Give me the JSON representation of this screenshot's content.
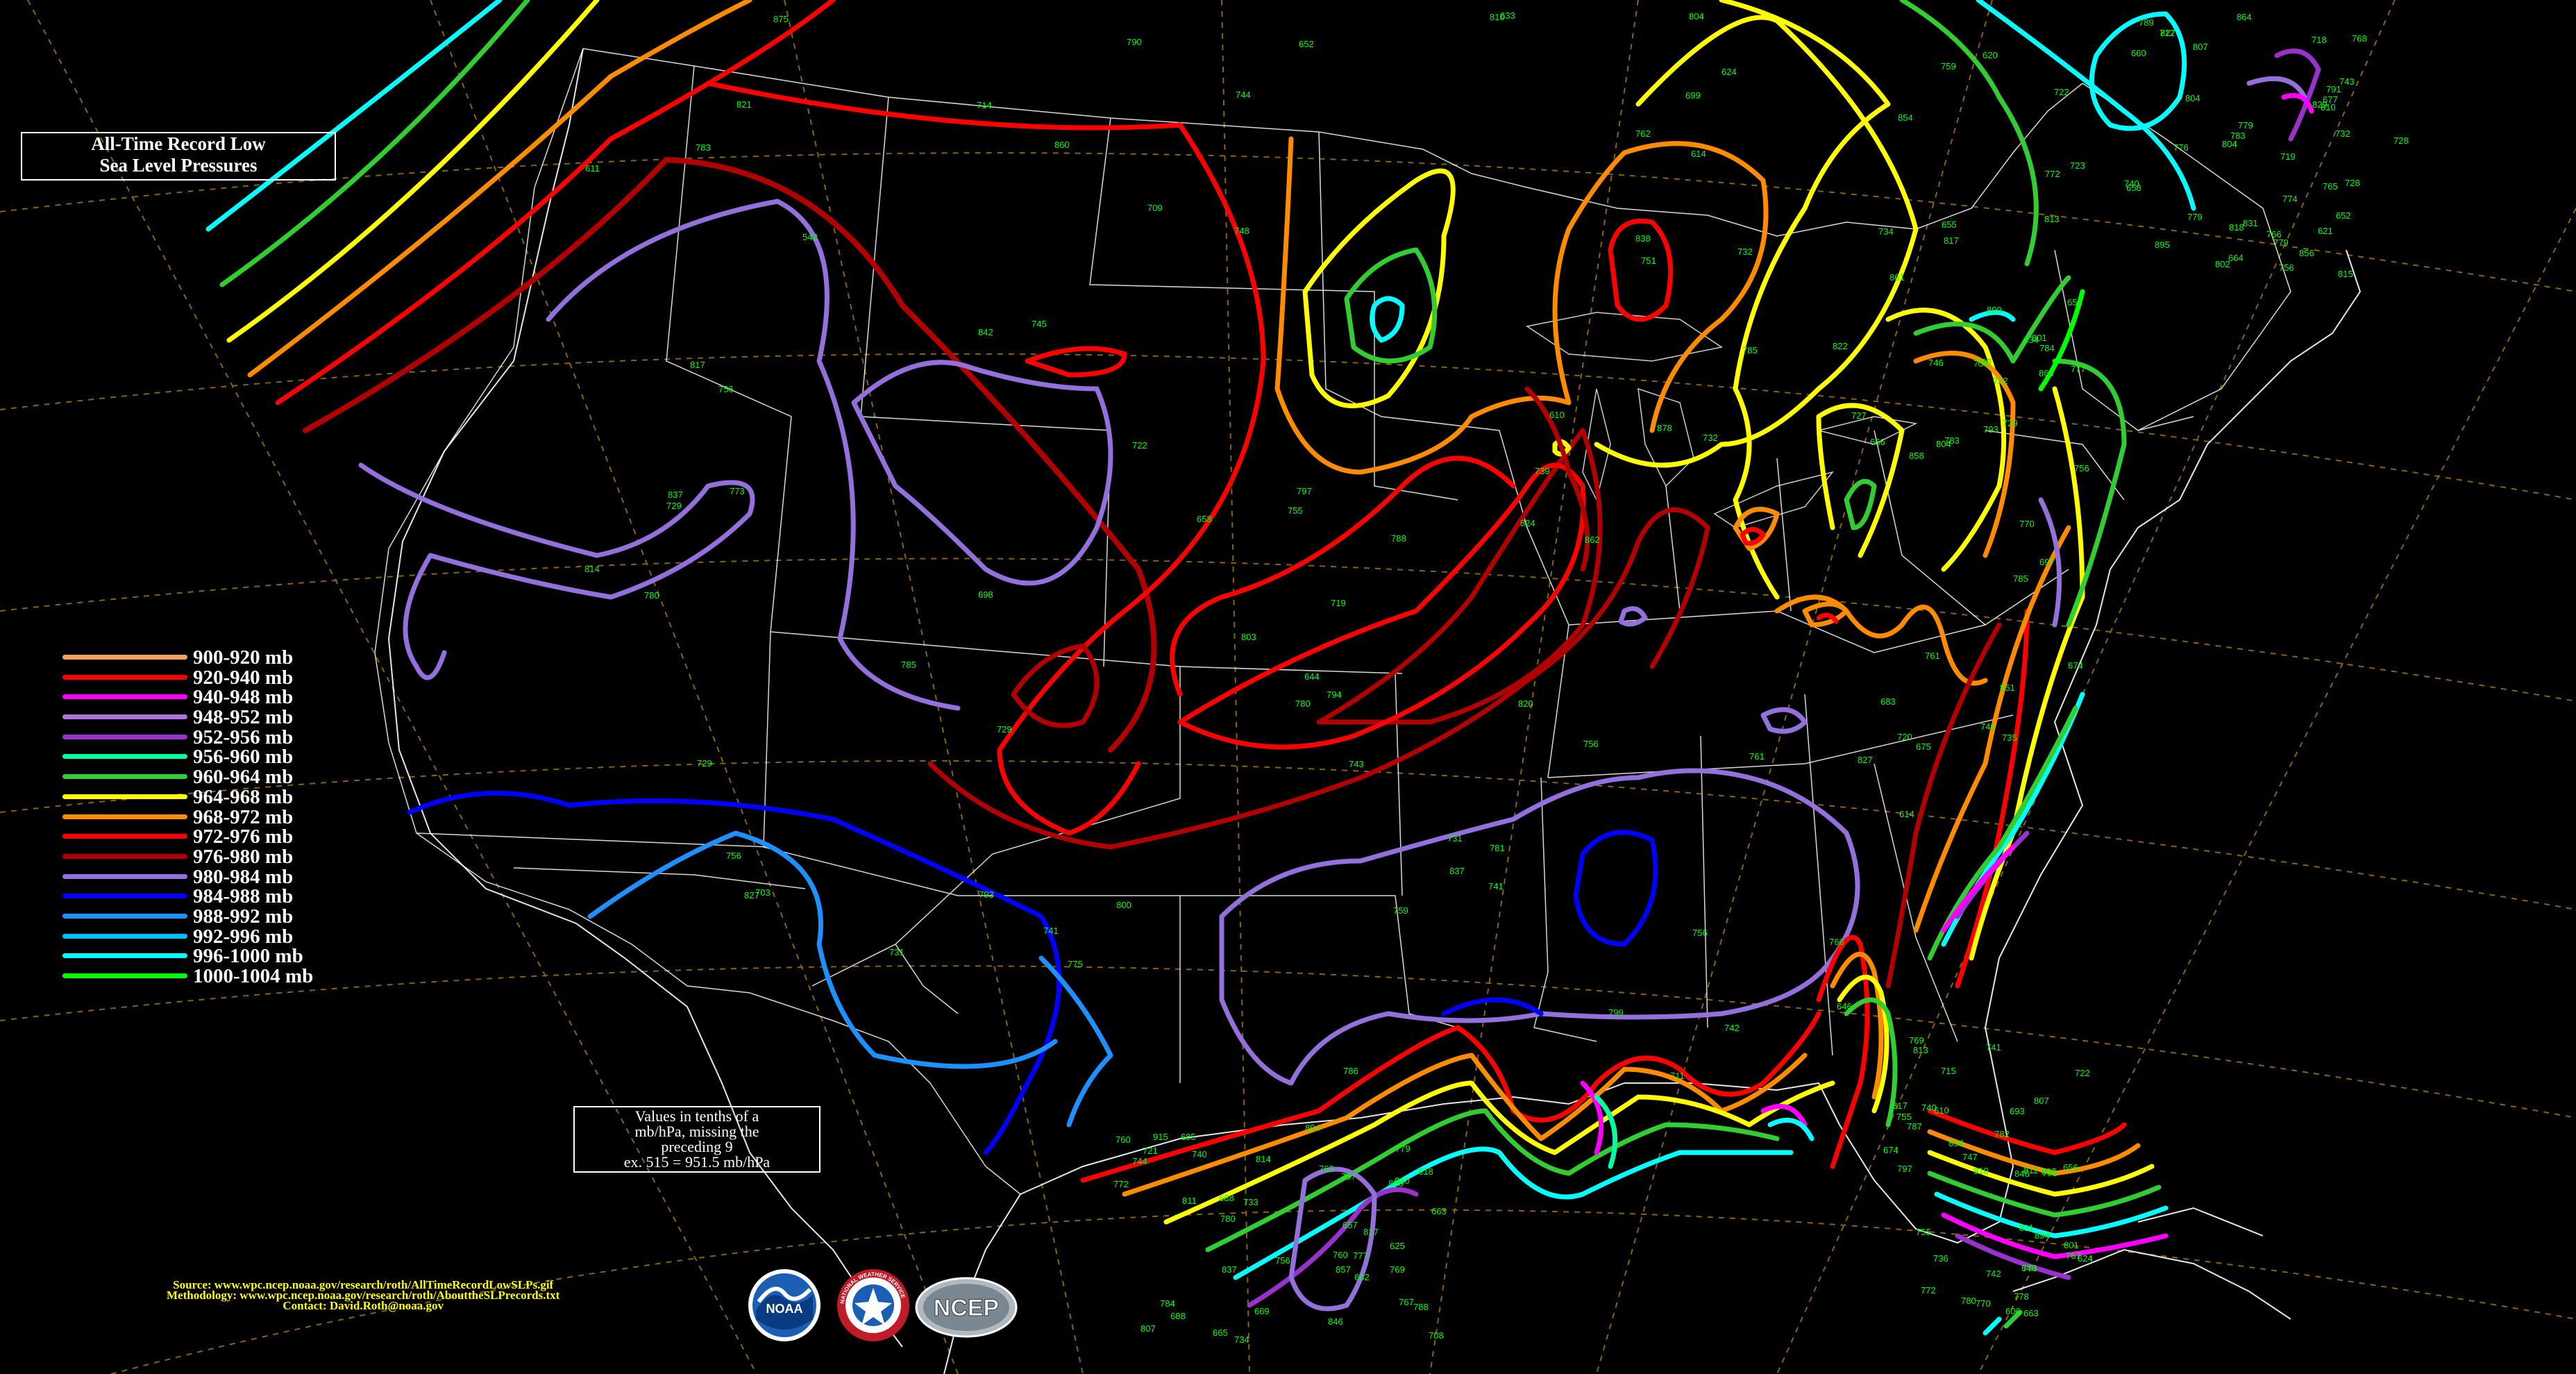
{
  "title": {
    "line1": "All-Time Record Low",
    "line2": "Sea Level Pressures"
  },
  "note": {
    "line1": "Values in tenths of a",
    "line2": "mb/hPa, missing the",
    "line3": "preceding 9",
    "line4": "ex. 515 = 951.5 mb/hPa"
  },
  "legend": [
    {
      "label": "900-920 mb",
      "color": "#f4a460"
    },
    {
      "label": "920-940 mb",
      "color": "#ff0000"
    },
    {
      "label": "940-948 mb",
      "color": "#ff00ff"
    },
    {
      "label": "948-952 mb",
      "color": "#b070e0"
    },
    {
      "label": "952-956 mb",
      "color": "#9932cc"
    },
    {
      "label": "956-960 mb",
      "color": "#00ffa0"
    },
    {
      "label": "960-964 mb",
      "color": "#32cd32"
    },
    {
      "label": "964-968 mb",
      "color": "#ffff00"
    },
    {
      "label": "968-972 mb",
      "color": "#ff8c00"
    },
    {
      "label": "972-976 mb",
      "color": "#ff0000"
    },
    {
      "label": "976-980 mb",
      "color": "#b00000"
    },
    {
      "label": "980-984 mb",
      "color": "#9370db"
    },
    {
      "label": "984-988 mb",
      "color": "#0000ff"
    },
    {
      "label": "988-992 mb",
      "color": "#1e90ff"
    },
    {
      "label": "992-996 mb",
      "color": "#00bfff"
    },
    {
      "label": "996-1000 mb",
      "color": "#00ffff"
    },
    {
      "label": "1000-1004 mb",
      "color": "#00ff00"
    }
  ],
  "credits": {
    "source": "Source: www.wpc.ncep.noaa.gov/research/roth/AllTimeRecordLowSLPs.gif",
    "methodology": "Methodology: www.wpc.ncep.noaa.gov/research/roth/AbouttheSLPrecords.txt",
    "contact": "Contact:  David.Roth@noaa.gov"
  },
  "logos": {
    "noaa": "NOAA",
    "nws": "NATIONAL WEATHER SERVICE",
    "ncep": "NCEP"
  },
  "station_values": [
    "745",
    "711",
    "697",
    "688",
    "646",
    "677",
    "709",
    "751",
    "761",
    "788",
    "797",
    "810",
    "756",
    "766",
    "753",
    "779",
    "787",
    "804",
    "797",
    "732",
    "740",
    "810",
    "742",
    "718",
    "714",
    "732",
    "813",
    "733",
    "780",
    "864",
    "783",
    "804",
    "817",
    "814",
    "805",
    "766",
    "729",
    "719",
    "793",
    "787",
    "770",
    "776",
    "803",
    "794",
    "801",
    "769",
    "736",
    "728",
    "780",
    "756",
    "785",
    "807",
    "817",
    "831",
    "827",
    "837",
    "739",
    "772",
    "773",
    "815",
    "793",
    "810",
    "804",
    "857",
    "846",
    "856",
    "860",
    "838",
    "865",
    "837",
    "854",
    "804",
    "814",
    "827",
    "851",
    "888",
    "910",
    "895",
    "875",
    "878",
    "854",
    "915",
    "894",
    "829",
    "837",
    "822",
    "720",
    "734",
    "740",
    "756",
    "729",
    "741",
    "783",
    "817",
    "811",
    "807",
    "790",
    "788",
    "800",
    "777",
    "782",
    "779",
    "842",
    "646",
    "634",
    "618",
    "674",
    "664",
    "652",
    "610",
    "675",
    "665",
    "663",
    "732",
    "741",
    "781",
    "770",
    "804",
    "801",
    "740",
    "756",
    "742",
    "735",
    "685",
    "772",
    "743",
    "703",
    "761",
    "772",
    "767",
    "807",
    "827",
    "817",
    "862",
    "861",
    "846",
    "813",
    "779",
    "785",
    "762",
    "777",
    "760",
    "715",
    "719",
    "722",
    "786",
    "674",
    "740",
    "778",
    "783",
    "780",
    "756",
    "729",
    "682",
    "610",
    "660",
    "658",
    "633",
    "614",
    "625",
    "624",
    "621",
    "644",
    "614",
    "651",
    "657",
    "656",
    "658",
    "611",
    "666",
    "620",
    "663",
    "606",
    "652",
    "542",
    "624",
    "683",
    "669",
    "693",
    "712",
    "698",
    "699",
    "655",
    "721",
    "755",
    "768",
    "731",
    "743",
    "784",
    "760",
    "755",
    "728",
    "729",
    "731",
    "734",
    "688",
    "747",
    "789",
    "744",
    "799",
    "723",
    "744",
    "767",
    "802",
    "821",
    "820",
    "722",
    "756",
    "741",
    "779",
    "800",
    "824",
    "858",
    "780",
    "793",
    "818",
    "755",
    "739",
    "756",
    "708",
    "722",
    "774",
    "773",
    "759",
    "759",
    "784",
    "769",
    "791",
    "748",
    "727",
    "746",
    "811",
    "812",
    "765",
    "775",
    "785",
    "722",
    "763"
  ],
  "colors": {
    "background": "#000000",
    "borders": "#ffffff",
    "graticule": "#b8860b",
    "station_values": "#00ff00"
  }
}
